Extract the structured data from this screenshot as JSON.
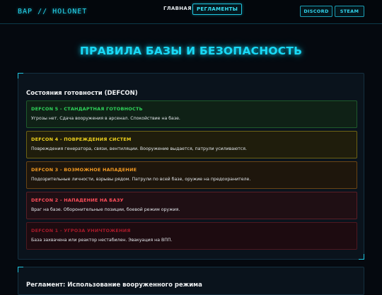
{
  "header": {
    "logo": "ВАР // HOLONET",
    "nav": [
      {
        "label": "ГЛАВНАЯ"
      },
      {
        "label": "РЕГЛАМЕНТЫ"
      }
    ],
    "buttons": [
      {
        "label": "DISCORD"
      },
      {
        "label": "STEAM"
      }
    ]
  },
  "page_title": "ПРАВИЛА БАЗЫ И БЕЗОПАСНОСТЬ",
  "defcon": {
    "title": "Состояния готовности (DEFCON)",
    "levels": [
      {
        "name": "DEFCON 5 - СТАНДАРТНАЯ ГОТОВНОСТЬ",
        "desc": "Угрозы нет. Сдача вооружения в арсенал. Спокойствие на базе.",
        "color": "#2fd45a"
      },
      {
        "name": "DEFCON 4 - ПОВРЕЖДЕНИЯ СИСТЕМ",
        "desc": "Повреждения генератора, связи, вентиляции. Вооружение выдается, патрули усиливаются.",
        "color": "#f0d21e"
      },
      {
        "name": "DEFCON 3 - ВОЗМОЖНОЕ НАПАДЕНИЕ",
        "desc": "Подозрительные личности, взрывы рядом. Патрули по всей базе, оружие на предохранителе.",
        "color": "#f39a22"
      },
      {
        "name": "DEFCON 2 - НАПАДЕНИЕ НА БАЗУ",
        "desc": "Враг на базе. Оборонительные позиции, боевой режим оружия.",
        "color": "#ff4d5a"
      },
      {
        "name": "DEFCON 1 - УГРОЗА УНИЧТОЖЕНИЯ",
        "desc": "База захвачена или реактор нестабилен. Эвакуация на ВПП.",
        "color": "#a81a2a"
      }
    ]
  },
  "next_section": {
    "title": "Регламент: Использование вооруженного режима"
  }
}
